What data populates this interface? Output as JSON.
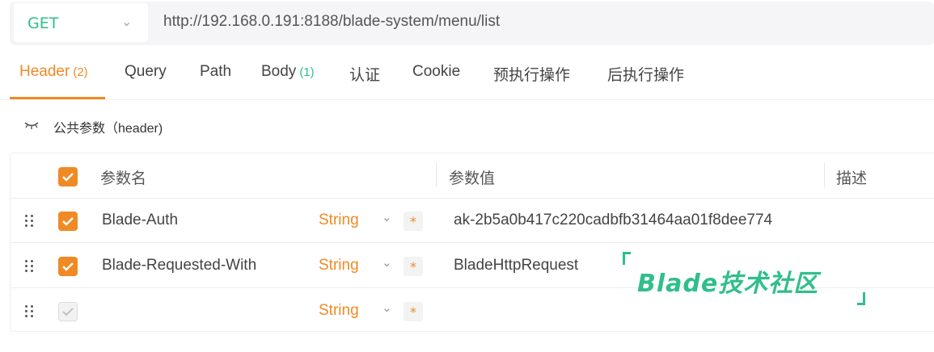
{
  "request": {
    "method": "GET",
    "url": "http://192.168.0.191:8188/blade-system/menu/list"
  },
  "tabs": [
    {
      "label": "Header",
      "count": "(2)",
      "active": true
    },
    {
      "label": "Query",
      "count": ""
    },
    {
      "label": "Path",
      "count": ""
    },
    {
      "label": "Body",
      "count": "(1)"
    },
    {
      "label": "认证",
      "count": ""
    },
    {
      "label": "Cookie",
      "count": ""
    },
    {
      "label": "预执行操作",
      "count": ""
    },
    {
      "label": "后执行操作",
      "count": ""
    }
  ],
  "public_params": {
    "label": "公共参数（header)"
  },
  "table": {
    "headers": {
      "name": "参数名",
      "value": "参数值",
      "desc": "描述"
    },
    "rows": [
      {
        "name": "Blade-Auth",
        "type": "String",
        "required": "*",
        "value": "ak-2b5a0b417c220cadbfb31464aa01f8dee774",
        "checked": true
      },
      {
        "name": "Blade-Requested-With",
        "type": "String",
        "required": "*",
        "value": "BladeHttpRequest",
        "checked": true
      },
      {
        "name": "",
        "type": "String",
        "required": "*",
        "value": "",
        "checked": false
      }
    ]
  },
  "watermark": {
    "text": "Blade技术社区"
  },
  "colors": {
    "accent": "#f08a24",
    "method_green": "#2fbf8a"
  },
  "icons": [
    "chevron-down-icon",
    "eye-closed-icon",
    "checkbox-icon",
    "drag-handle-icon"
  ]
}
